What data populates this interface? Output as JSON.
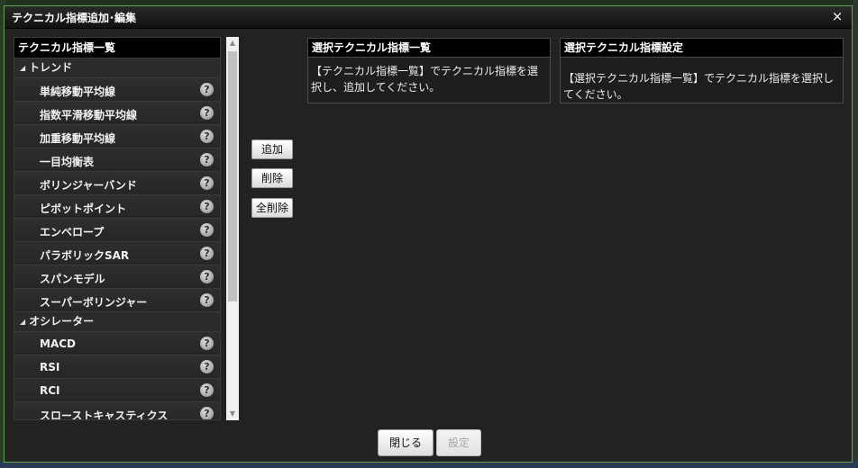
{
  "dialog": {
    "title": "テクニカル指標追加･編集",
    "close_glyph": "×"
  },
  "indicator_list": {
    "header": "テクニカル指標一覧",
    "groups": [
      {
        "label": "トレンド",
        "items": [
          {
            "label": "単純移動平均線"
          },
          {
            "label": "指数平滑移動平均線"
          },
          {
            "label": "加重移動平均線"
          },
          {
            "label": "一目均衡表"
          },
          {
            "label": "ボリンジャーバンド"
          },
          {
            "label": "ピボットポイント"
          },
          {
            "label": "エンベロープ"
          },
          {
            "label": "パラボリックSAR"
          },
          {
            "label": "スパンモデル"
          },
          {
            "label": "スーパーボリンジャー"
          }
        ]
      },
      {
        "label": "オシレーター",
        "items": [
          {
            "label": "MACD"
          },
          {
            "label": "RSI"
          },
          {
            "label": "RCI"
          },
          {
            "label": "スローストキャスティクス"
          }
        ]
      }
    ],
    "help_glyph": "?",
    "expand_glyph": "◢"
  },
  "scrollbar": {
    "up_glyph": "▲",
    "down_glyph": "▼"
  },
  "actions": {
    "add": "追加",
    "delete": "削除",
    "delete_all": "全削除"
  },
  "selected_panel": {
    "header": "選択テクニカル指標一覧",
    "message": "【テクニカル指標一覧】でテクニカル指標を選択し、追加してください。"
  },
  "settings_panel": {
    "header": "選択テクニカル指標設定",
    "message": "【選択テクニカル指標一覧】でテクニカル指標を選択してください。"
  },
  "footer": {
    "close": "閉じる",
    "set": "設定"
  },
  "colors": {
    "dialog_border": "#5fa84a",
    "dialog_bg": "#222222",
    "header_bg": "#000000"
  }
}
